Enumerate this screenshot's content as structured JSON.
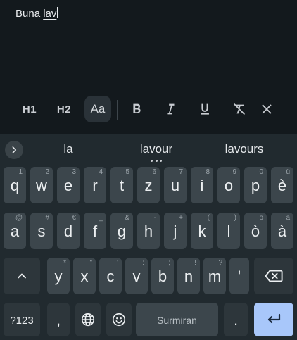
{
  "editor": {
    "text_plain": "Buna ",
    "text_composing": "lav"
  },
  "format_toolbar": {
    "h1_label": "H1",
    "h2_label": "H2",
    "text_style_label": "Aa",
    "icons": [
      "bold-icon",
      "italic-icon",
      "underline-icon",
      "clear-format-icon",
      "close-icon"
    ]
  },
  "suggestions": {
    "items": [
      "la",
      "lavour",
      "lavours"
    ]
  },
  "keyboard": {
    "row1": [
      {
        "label": "q",
        "hint": "1"
      },
      {
        "label": "w",
        "hint": "2"
      },
      {
        "label": "e",
        "hint": "3"
      },
      {
        "label": "r",
        "hint": "4"
      },
      {
        "label": "t",
        "hint": "5"
      },
      {
        "label": "z",
        "hint": "6"
      },
      {
        "label": "u",
        "hint": "7"
      },
      {
        "label": "i",
        "hint": "8"
      },
      {
        "label": "o",
        "hint": "9"
      },
      {
        "label": "p",
        "hint": "0"
      },
      {
        "label": "è",
        "hint": "ü"
      }
    ],
    "row2": [
      {
        "label": "a",
        "hint": "@"
      },
      {
        "label": "s",
        "hint": "#"
      },
      {
        "label": "d",
        "hint": "€"
      },
      {
        "label": "f",
        "hint": "_"
      },
      {
        "label": "g",
        "hint": "&"
      },
      {
        "label": "h",
        "hint": "-"
      },
      {
        "label": "j",
        "hint": "+"
      },
      {
        "label": "k",
        "hint": "("
      },
      {
        "label": "l",
        "hint": ")"
      },
      {
        "label": "ò",
        "hint": "ö"
      },
      {
        "label": "à",
        "hint": "ä"
      }
    ],
    "row3": [
      {
        "label": "y",
        "hint": "*"
      },
      {
        "label": "x",
        "hint": "\""
      },
      {
        "label": "c",
        "hint": "'"
      },
      {
        "label": "v",
        "hint": ":"
      },
      {
        "label": "b",
        "hint": ";"
      },
      {
        "label": "n",
        "hint": "!"
      },
      {
        "label": "m",
        "hint": "?"
      },
      {
        "label": "'",
        "hint": ""
      }
    ],
    "shift_label": "^",
    "symbols_label": "?123",
    "comma_label": ",",
    "space_label": "Surmiran",
    "period_label": "."
  },
  "colors": {
    "background": "#13191d",
    "keyboard_bg": "#212a2f",
    "key_bg": "#3c464c",
    "enter_bg": "#a8c7fa"
  }
}
